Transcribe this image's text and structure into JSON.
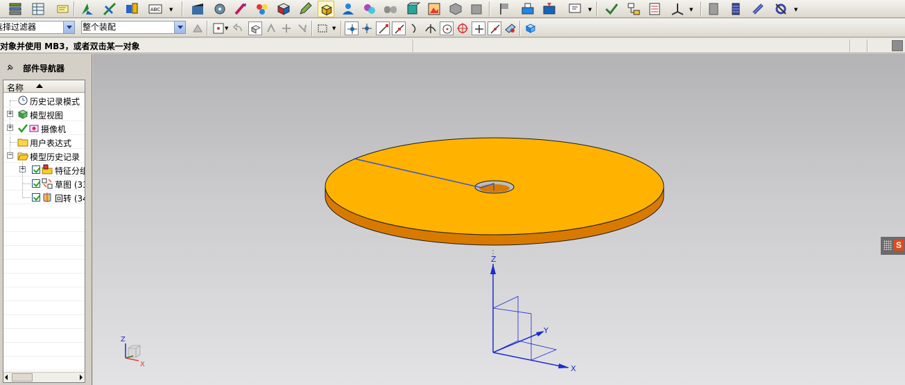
{
  "toolbar2": {
    "filter_combo": "选择过滤器",
    "scope_combo": "整个装配"
  },
  "status": {
    "message": "对象并使用 MB3，或者双击某一对象"
  },
  "navigator": {
    "title": "部件导航器",
    "column_name": "名称",
    "items": [
      {
        "label": "历史记录模式",
        "icon": "clock-icon"
      },
      {
        "label": "模型视图",
        "icon": "model-views-icon"
      },
      {
        "label": "摄像机",
        "icon": "camera-icon"
      },
      {
        "label": "用户表达式",
        "icon": "folder-icon"
      },
      {
        "label": "模型历史记录",
        "icon": "open-folder-icon"
      },
      {
        "label": "特征分组",
        "icon": "feature-group-icon"
      },
      {
        "label": "草图 (33",
        "icon": "sketch-icon"
      },
      {
        "label": "回转 (34",
        "icon": "revolve-icon"
      }
    ]
  },
  "viewport": {
    "main_axes": {
      "z": "Z",
      "y": "Y",
      "x": "X"
    },
    "triad": {
      "z": "Z",
      "x": "X"
    },
    "part_colors": {
      "top": "#ffb300",
      "side": "#d97a00",
      "edge": "#1a1a1a",
      "sketch_line": "#3355cc"
    }
  }
}
